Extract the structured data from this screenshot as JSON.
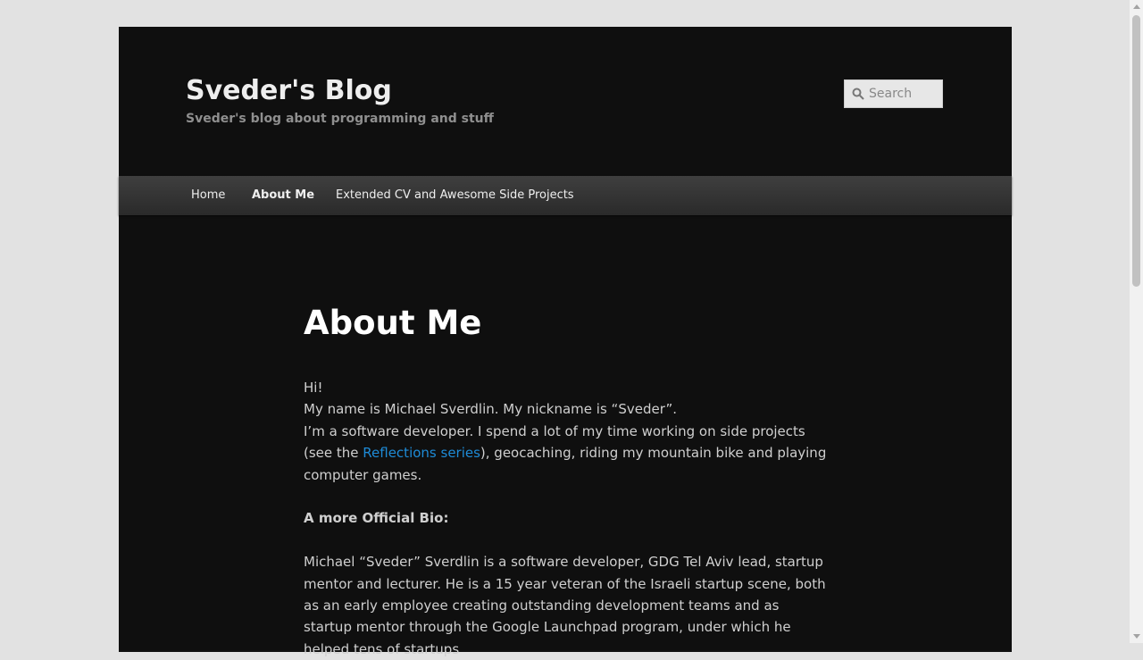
{
  "header": {
    "site_title": "Sveder's Blog",
    "site_description": "Sveder's blog about programming and stuff",
    "search_placeholder": "Search"
  },
  "nav": {
    "items": [
      {
        "label": "Home",
        "current": false
      },
      {
        "label": "About Me",
        "current": true
      },
      {
        "label": "Extended CV and Awesome Side Projects",
        "current": false
      }
    ]
  },
  "article": {
    "title": "About Me",
    "greeting": "Hi!",
    "intro_name": "My name is Michael Sverdlin. My nickname is “Sveder”.",
    "intro_before_link": "I’m a software developer. I spend a lot of my time working on side projects (see the ",
    "link_text": "Reflections series",
    "intro_after_link": "), geocaching, riding my mountain bike and playing computer games.",
    "bio_heading": "A more Official Bio:",
    "bio_text": "Michael “Sveder” Sverdlin is a software developer, GDG Tel Aviv lead, startup mentor and lecturer. He is a 15 year veteran of the Israeli startup scene, both as an early employee creating outstanding development teams and as startup mentor through the Google Launchpad program, under which he helped tens of startups"
  },
  "colors": {
    "page_background": "#e2e2e2",
    "content_background": "#0f0f0f",
    "nav_background": "#333333",
    "link": "#1e8bd7"
  }
}
